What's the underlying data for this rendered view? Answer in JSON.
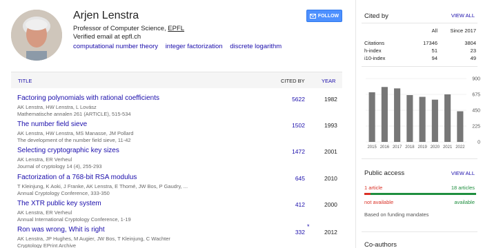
{
  "profile": {
    "name": "Arjen Lenstra",
    "affiliation_prefix": "Professor of Computer Science, ",
    "affiliation_link": "EPFL",
    "verified": "Verified email at epfl.ch",
    "interests": [
      "computational number theory",
      "integer factorization",
      "discrete logarithm"
    ]
  },
  "follow_label": "FOLLOW",
  "table": {
    "headers": {
      "title": "TITLE",
      "cited_by": "CITED BY",
      "year": "YEAR"
    },
    "rows": [
      {
        "title": "Factoring polynomials with rational coefficients",
        "authors": "AK Lenstra, HW Lenstra, L Lovász",
        "venue": "Mathematische annalen 261 (ARTICLE), 515-534",
        "cites": "5622",
        "year": "1982",
        "star": ""
      },
      {
        "title": "The number field sieve",
        "authors": "AK Lenstra, HW Lenstra, MS Manasse, JM Pollard",
        "venue": "The development of the number field sieve, 11-42",
        "cites": "1502",
        "year": "1993",
        "star": ""
      },
      {
        "title": "Selecting cryptographic key sizes",
        "authors": "AK Lenstra, ER Verheul",
        "venue": "Journal of cryptology 14 (4), 255-293",
        "cites": "1472",
        "year": "2001",
        "star": ""
      },
      {
        "title": "Factorization of a 768-bit RSA modulus",
        "authors": "T Kleinjung, K Aoki, J Franke, AK Lenstra, E Thomé, JW Bos, P Gaudry, ...",
        "venue": "Annual Cryptology Conference, 333-350",
        "cites": "645",
        "year": "2010",
        "star": ""
      },
      {
        "title": "The XTR public key system",
        "authors": "AK Lenstra, ER Verheul",
        "venue": "Annual International Cryptology Conference, 1-19",
        "cites": "412",
        "year": "2000",
        "star": ""
      },
      {
        "title": "Ron was wrong, Whit is right",
        "authors": "AK Lenstra, JP Hughes, M Augier, JW Bos, T Kleinjung, C Wachter",
        "venue": "Cryptology EPrint Archive",
        "cites": "332",
        "year": "2012",
        "star": "*"
      }
    ]
  },
  "cited_by": {
    "title": "Cited by",
    "view_all": "VIEW ALL",
    "col_all": "All",
    "col_since": "Since 2017",
    "metrics": [
      {
        "label": "Citations",
        "all": "17346",
        "since": "3804"
      },
      {
        "label": "h-index",
        "all": "51",
        "since": "23"
      },
      {
        "label": "i10-index",
        "all": "94",
        "since": "49"
      }
    ]
  },
  "chart_data": {
    "type": "bar",
    "categories": [
      "2015",
      "2016",
      "2017",
      "2018",
      "2019",
      "2020",
      "2021",
      "2022"
    ],
    "values": [
      705,
      780,
      760,
      665,
      640,
      600,
      675,
      435
    ],
    "ylim": [
      0,
      900
    ],
    "yticks": [
      "900",
      "675",
      "450",
      "225",
      "0"
    ],
    "bar_color": "#777777"
  },
  "public_access": {
    "title": "Public access",
    "view_all": "VIEW ALL",
    "left_count": "1 article",
    "right_count": "18 articles",
    "left_status": "not available",
    "right_status": "available",
    "available_fraction": 0.947,
    "note": "Based on funding mandates",
    "red": "#d93025",
    "green": "#1e8e3e"
  },
  "coauthors": {
    "title": "Co-authors"
  }
}
